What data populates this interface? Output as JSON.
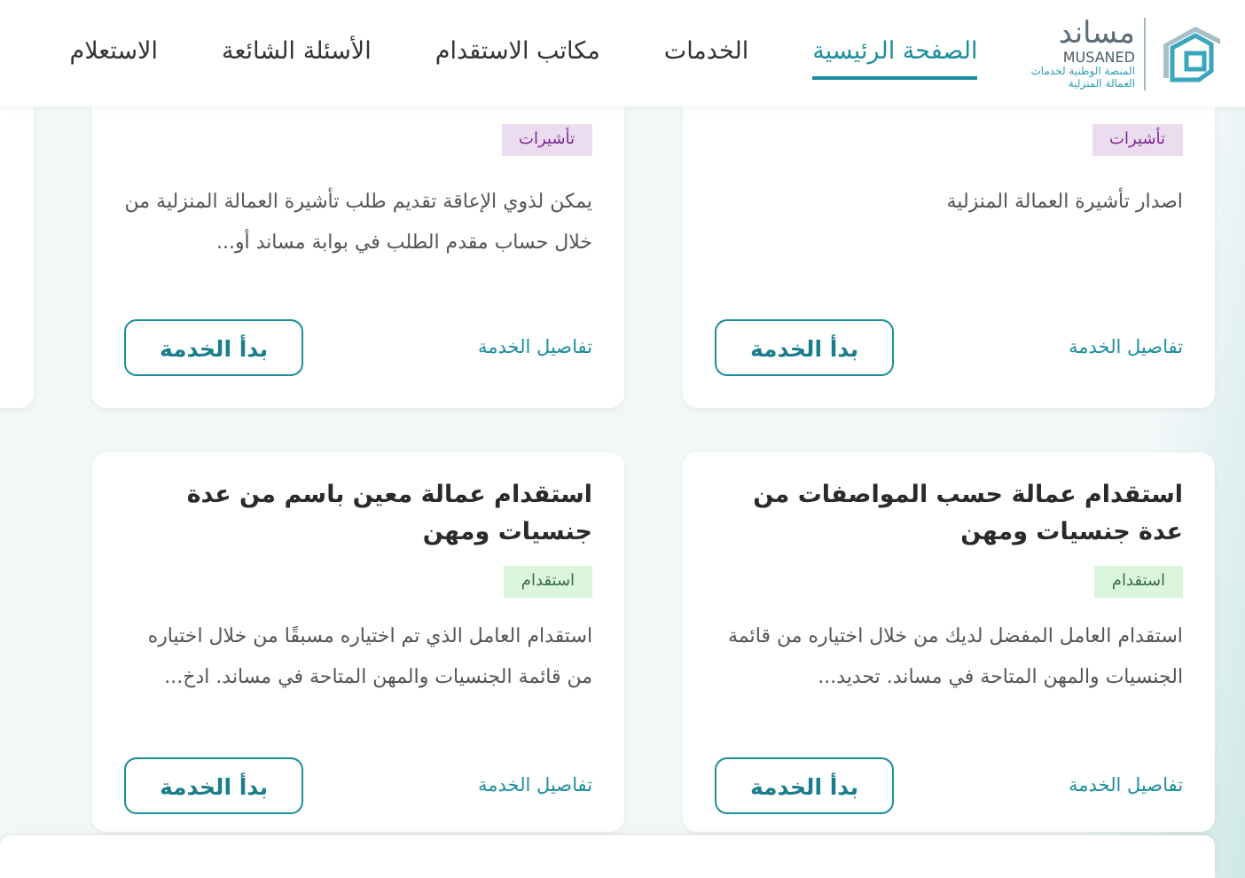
{
  "header": {
    "logo": {
      "name": "مساند",
      "latin": "MUSANED",
      "tagline": [
        "المنصة الوطنية لخدمات",
        "العمالة المنزلية"
      ]
    },
    "nav": [
      {
        "label": "الصفحة الرئيسية",
        "selected": true
      },
      {
        "label": "الخدمات",
        "selected": false
      },
      {
        "label": "مكاتب الاستقدام",
        "selected": false
      },
      {
        "label": "الأسئلة الشائعة",
        "selected": false
      },
      {
        "label": "الاستعلام",
        "selected": false
      }
    ]
  },
  "cards": [
    {
      "tag": {
        "label": "تأشيرات",
        "kind": "visa"
      },
      "description": "اصدار تأشيرة العمالة المنزلية",
      "details_link": "تفاصيل الخدمة",
      "start_button": "بدأ الخدمة"
    },
    {
      "tag": {
        "label": "تأشيرات",
        "kind": "visa"
      },
      "description": "يمكن لذوي الإعاقة تقديم طلب تأشيرة العمالة المنزلية من خلال حساب مقدم الطلب في بوابة مساند أو...",
      "details_link": "تفاصيل الخدمة",
      "start_button": "بدأ الخدمة"
    },
    {
      "title": "استقدام عمالة حسب المواصفات من عدة جنسيات ومهن",
      "tag": {
        "label": "استقدام",
        "kind": "recruitment"
      },
      "description": "استقدام العامل المفضل لديك من خلال اختياره من قائمة الجنسيات والمهن المتاحة في مساند. تحديد...",
      "details_link": "تفاصيل الخدمة",
      "start_button": "بدأ الخدمة"
    },
    {
      "title": "استقدام عمالة معين باسم من عدة جنسيات ومهن",
      "tag": {
        "label": "استقدام",
        "kind": "recruitment"
      },
      "description": "استقدام العامل الذي تم اختياره مسبقًا من خلال اختياره من قائمة الجنسيات والمهن المتاحة في مساند. ادخ...",
      "details_link": "تفاصيل الخدمة",
      "start_button": "بدأ الخدمة"
    }
  ]
}
